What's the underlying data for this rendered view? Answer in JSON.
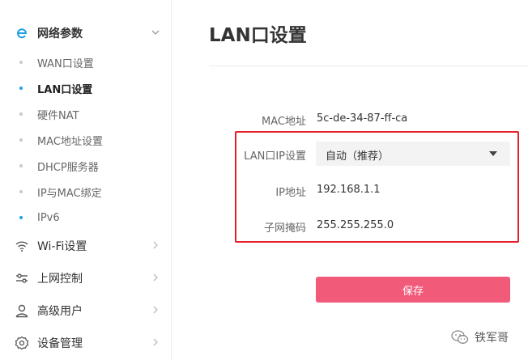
{
  "sidebar": {
    "sections": [
      {
        "label": "网络参数",
        "icon": "network-e-icon",
        "expanded": true
      },
      {
        "label": "Wi-Fi设置",
        "icon": "wifi-icon"
      },
      {
        "label": "上网控制",
        "icon": "sliders-icon"
      },
      {
        "label": "高级用户",
        "icon": "user-icon"
      },
      {
        "label": "设备管理",
        "icon": "gear-icon"
      }
    ],
    "subitems": [
      {
        "label": "WAN口设置"
      },
      {
        "label": "LAN口设置",
        "active": true
      },
      {
        "label": "硬件NAT"
      },
      {
        "label": "MAC地址设置"
      },
      {
        "label": "DHCP服务器"
      },
      {
        "label": "IP与MAC绑定"
      },
      {
        "label": "IPv6"
      }
    ]
  },
  "main": {
    "title": "LAN口设置",
    "mac": {
      "label": "MAC地址",
      "value": "5c-de-34-87-ff-ca"
    },
    "lan_ip_mode": {
      "label": "LAN口IP设置",
      "value": "自动（推荐）"
    },
    "ip": {
      "label": "IP地址",
      "value": "192.168.1.1"
    },
    "mask": {
      "label": "子网掩码",
      "value": "255.255.255.0"
    },
    "save_label": "保存"
  },
  "watermark": {
    "text": "铁军哥",
    "icon": "wechat-icon"
  },
  "colors": {
    "accent_blue": "#1ea0e6",
    "save_button": "#f25a7a",
    "highlight_box": "#e5202a"
  }
}
